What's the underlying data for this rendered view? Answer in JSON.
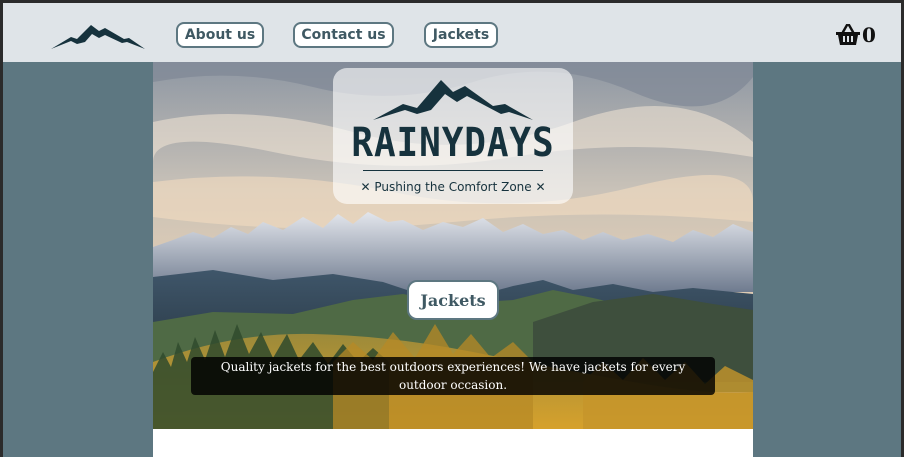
{
  "header": {
    "nav": [
      {
        "label": "About us"
      },
      {
        "label": "Contact us"
      },
      {
        "label": "Jackets"
      }
    ],
    "cart": {
      "icon": "basket-icon",
      "count": "0"
    }
  },
  "hero": {
    "brand_name": "RAINYDAYS",
    "tagline": "✕ Pushing the Comfort Zone ✕",
    "button_label": "Jackets",
    "text": "Quality jackets for the best outdoors experiences! We have jackets for every outdoor occasion."
  },
  "colors": {
    "header_bg": "#dfe4e8",
    "page_bg": "#5d7781",
    "brand_dark": "#16323d",
    "button_text": "#3f5963"
  }
}
